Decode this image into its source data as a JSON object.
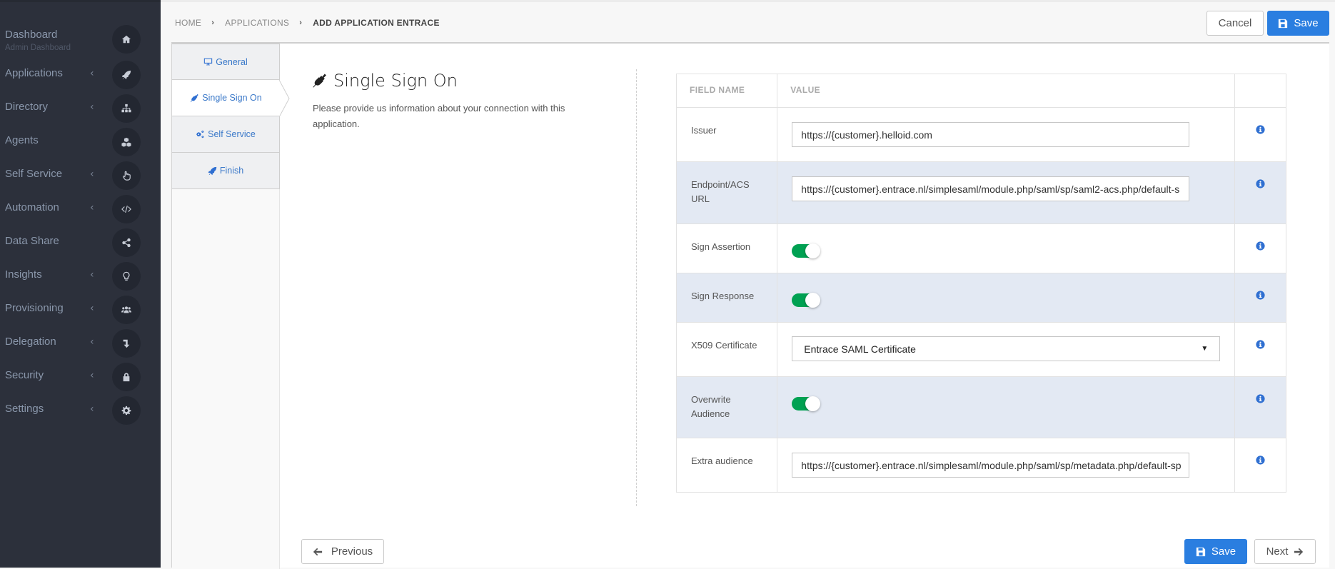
{
  "sidebar": {
    "items": [
      {
        "label": "Dashboard",
        "sublabel": "Admin Dashboard",
        "icon": "home-icon",
        "has_chevron": false
      },
      {
        "label": "Applications",
        "icon": "rocket-icon",
        "has_chevron": true
      },
      {
        "label": "Directory",
        "icon": "sitemap-icon",
        "has_chevron": true
      },
      {
        "label": "Agents",
        "icon": "cubes-icon",
        "has_chevron": false
      },
      {
        "label": "Self Service",
        "icon": "hand-pointer-icon",
        "has_chevron": true
      },
      {
        "label": "Automation",
        "icon": "code-icon",
        "has_chevron": true
      },
      {
        "label": "Data Share",
        "icon": "share-icon",
        "has_chevron": false
      },
      {
        "label": "Insights",
        "icon": "lightbulb-icon",
        "has_chevron": true
      },
      {
        "label": "Provisioning",
        "icon": "users-icon",
        "has_chevron": true
      },
      {
        "label": "Delegation",
        "icon": "level-down-icon",
        "has_chevron": true
      },
      {
        "label": "Security",
        "icon": "lock-icon",
        "has_chevron": true
      },
      {
        "label": "Settings",
        "icon": "gear-icon",
        "has_chevron": true
      }
    ],
    "chevron": "‹"
  },
  "breadcrumb": {
    "items": [
      "HOME",
      "APPLICATIONS",
      "ADD APPLICATION ENTRACE"
    ],
    "separator": "›"
  },
  "header": {
    "cancel_label": "Cancel",
    "save_label": "Save"
  },
  "steps": [
    {
      "label": "General",
      "icon": "desktop-icon",
      "active": false
    },
    {
      "label": "Single Sign On",
      "icon": "plug-icon",
      "active": true
    },
    {
      "label": "Self Service",
      "icon": "cogs-icon",
      "active": false
    },
    {
      "label": "Finish",
      "icon": "rocket-icon",
      "active": false
    }
  ],
  "section": {
    "title": "Single Sign On",
    "description": "Please provide us information about your connection with this application."
  },
  "table": {
    "headers": [
      "FIELD NAME",
      "VALUE",
      ""
    ],
    "rows": [
      {
        "field": "Issuer",
        "type": "text",
        "value": "https://{customer}.helloid.com"
      },
      {
        "field": "Endpoint/ACS URL",
        "type": "text",
        "value": "https://{customer}.entrace.nl/simplesaml/module.php/saml/sp/saml2-acs.php/default-s"
      },
      {
        "field": "Sign Assertion",
        "type": "toggle",
        "value": true
      },
      {
        "field": "Sign Response",
        "type": "toggle",
        "value": true
      },
      {
        "field": "X509 Certificate",
        "type": "select",
        "value": "Entrace SAML Certificate"
      },
      {
        "field": "Overwrite Audience",
        "type": "toggle",
        "value": true
      },
      {
        "field": "Extra audience",
        "type": "text",
        "value": "https://{customer}.entrace.nl/simplesaml/module.php/saml/sp/metadata.php/default-sp"
      }
    ]
  },
  "footer": {
    "previous_label": "Previous",
    "save_label": "Save",
    "next_label": "Next"
  },
  "colors": {
    "sidebar_bg": "#2c303b",
    "primary": "#2a7ee0",
    "toggle_on": "#00a152",
    "alt_row": "#e3e9f3",
    "link": "#3b79c9"
  }
}
